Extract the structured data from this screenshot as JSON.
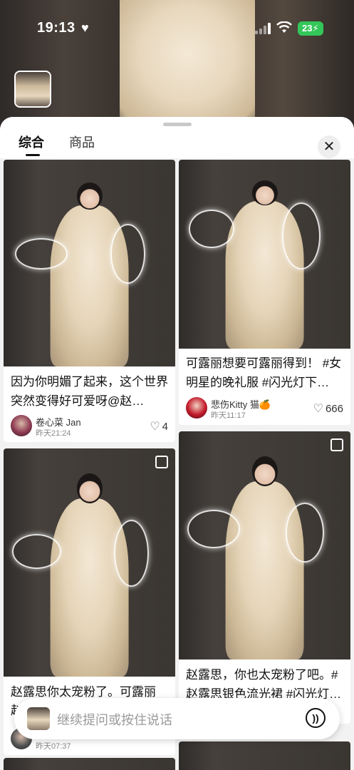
{
  "status_bar": {
    "time": "19:13",
    "battery": "23"
  },
  "tabs": [
    {
      "label": "综合",
      "active": true
    },
    {
      "label": "商品",
      "active": false
    }
  ],
  "close_icon": "close-icon",
  "cards": [
    {
      "title": "因为你明媚了起来，这个世界突然变得好可爱呀@赵…",
      "author": "卷心菜 Jan",
      "date": "昨天21:24",
      "likes": "4",
      "multi_image": false
    },
    {
      "title": "可露丽想要可露丽得到！ #女明星的晚礼服 #闪光灯下…",
      "author": "悲伤Kitty 猫🍊",
      "date": "昨天11:17",
      "likes": "666",
      "multi_image": false
    },
    {
      "title": "赵露思你太宠粉了。可露丽",
      "title_cont": "赵",
      "author": "",
      "date": "昨天07:37",
      "likes": "",
      "multi_image": true
    },
    {
      "title": "赵露思，你也太宠粉了吧。#赵露思银色流光裙 #闪光灯…",
      "author": "",
      "date": "",
      "likes": "",
      "multi_image": true
    }
  ],
  "input": {
    "placeholder": "继续提问或按住说话"
  },
  "colors": {
    "battery": "#33c759",
    "background": "#f2f2f2"
  }
}
